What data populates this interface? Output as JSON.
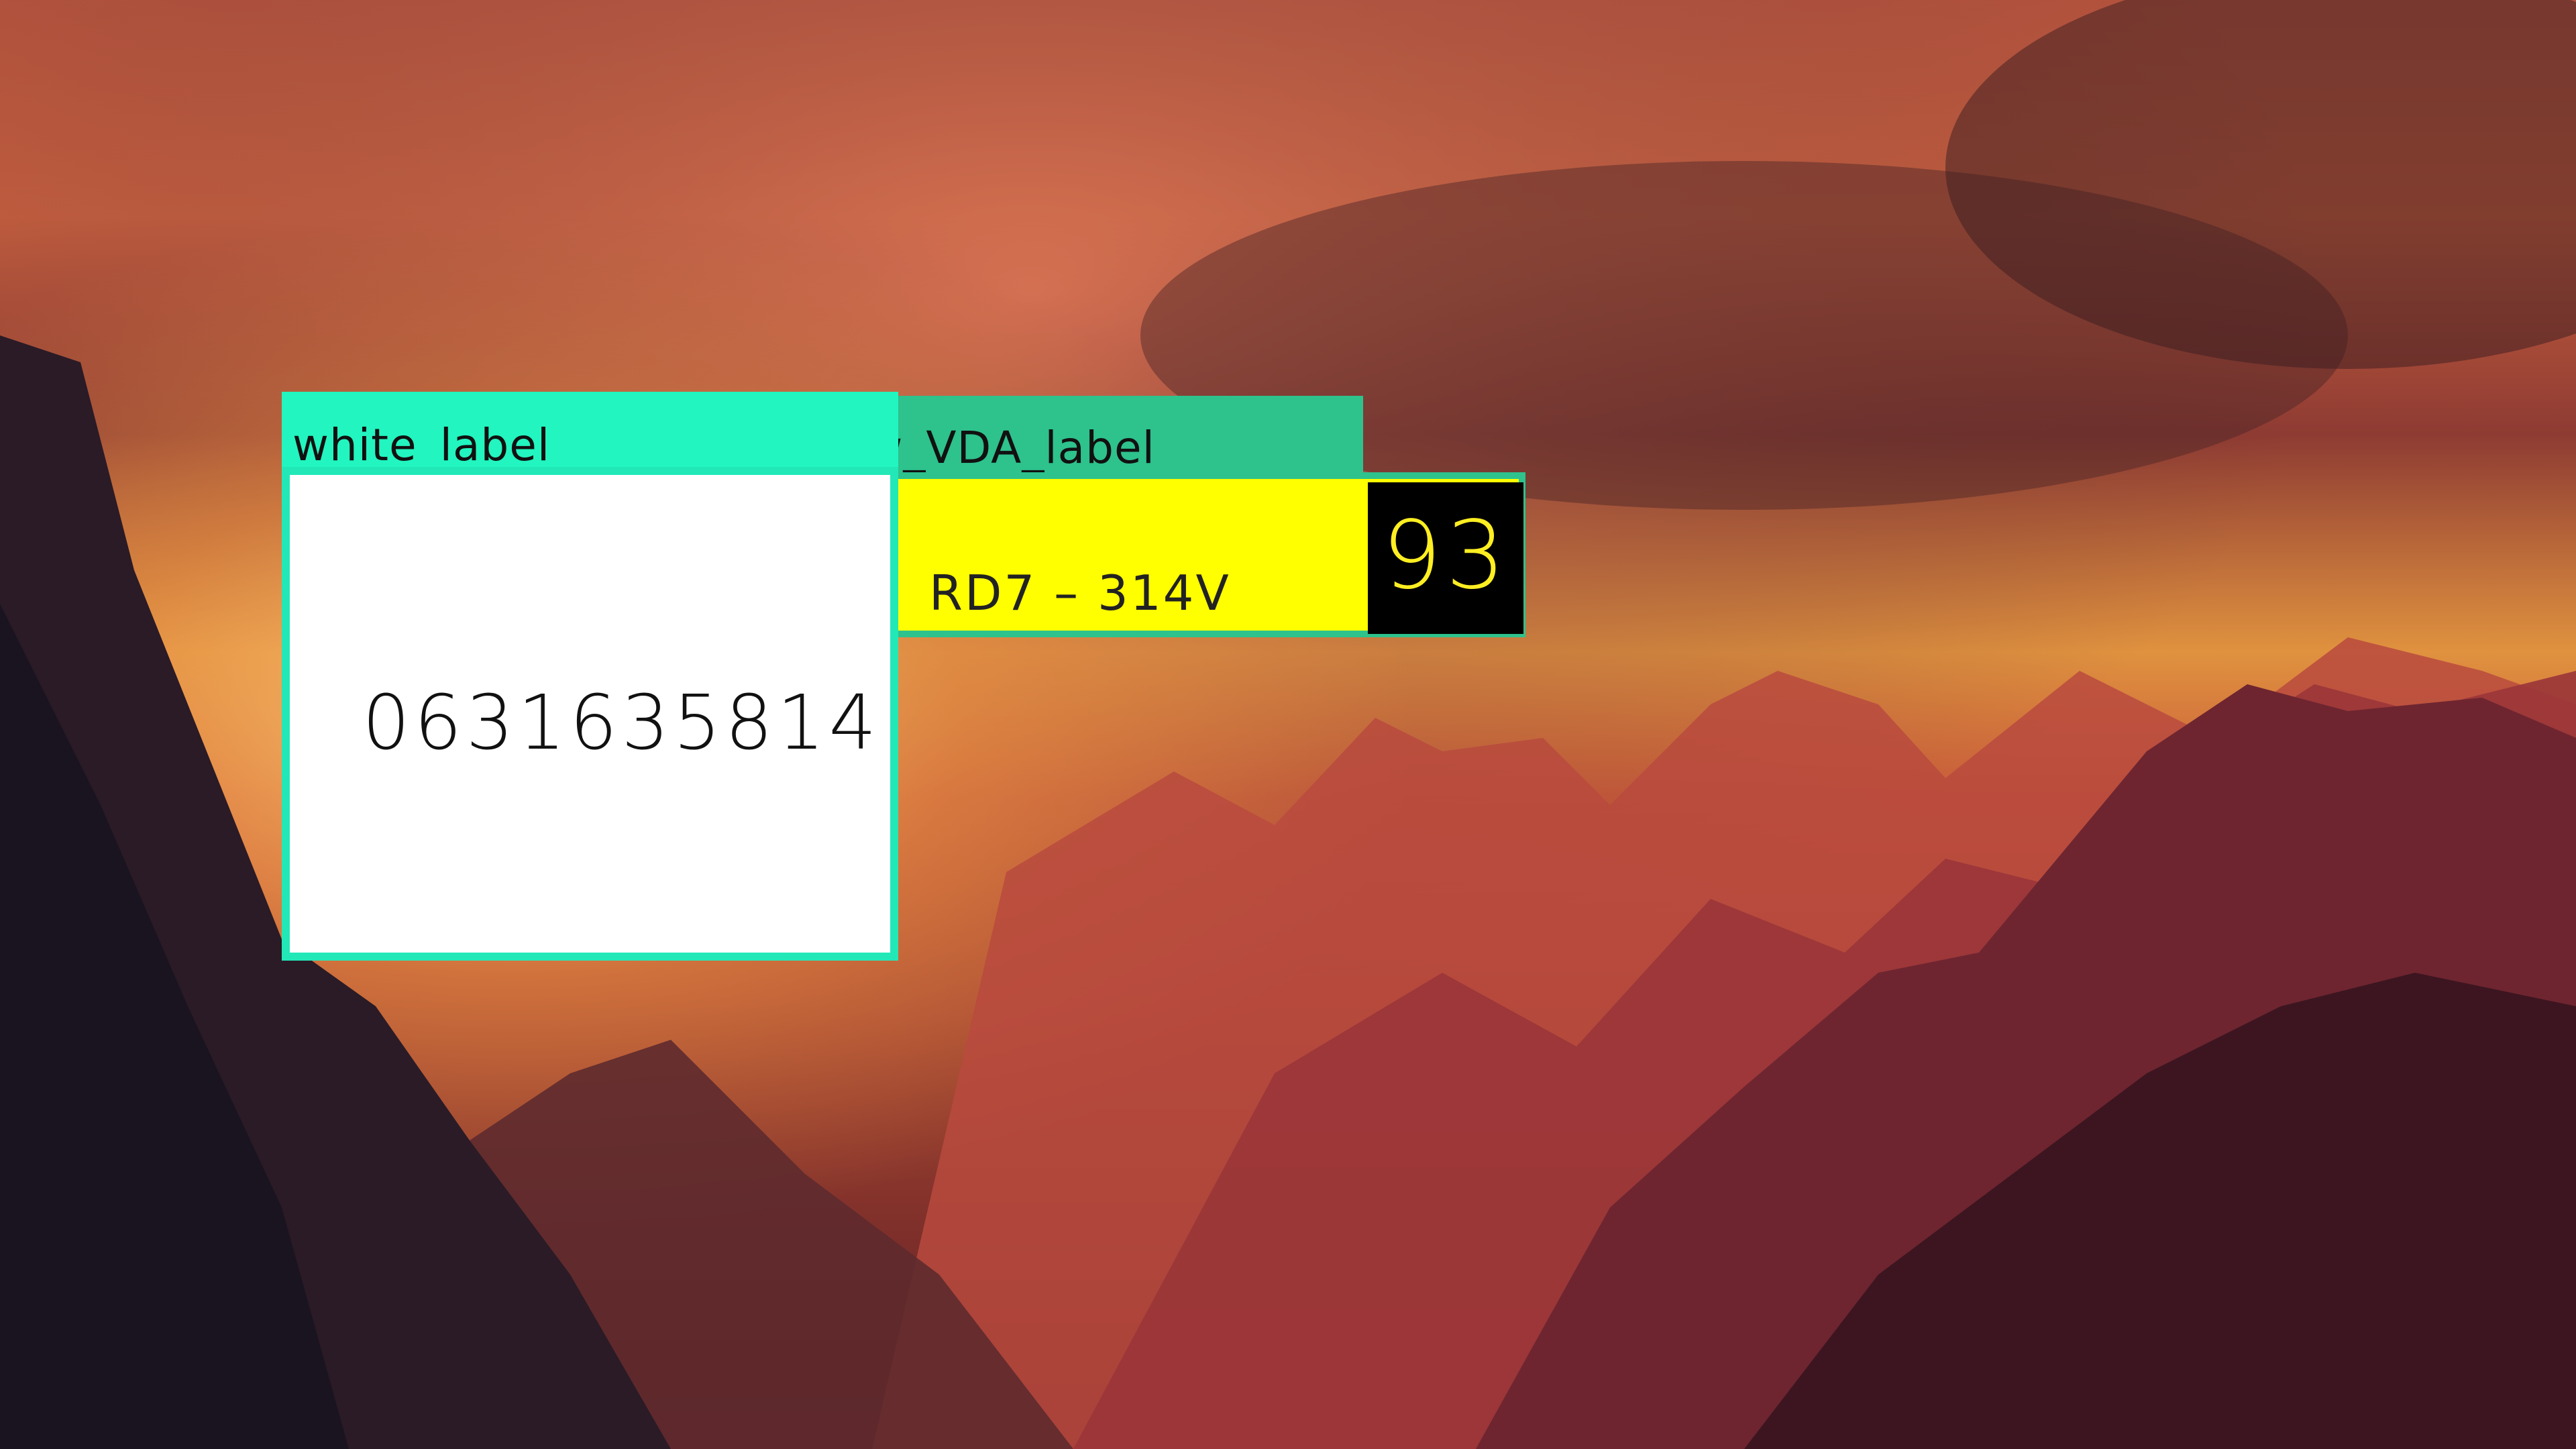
{
  "windows": {
    "white_label": {
      "title": "white_label",
      "value": "0631635814",
      "colors": {
        "header": "#22f5bf",
        "border": "#22e8b8",
        "body": "#ffffff"
      }
    },
    "yellow_label": {
      "title": "ow_VDA_label",
      "value": "RD7 – 314V",
      "badge": "93",
      "colors": {
        "header": "#2ec28d",
        "body": "#ffff00",
        "badge_bg": "#000000",
        "badge_text": "#ffee22"
      }
    }
  }
}
